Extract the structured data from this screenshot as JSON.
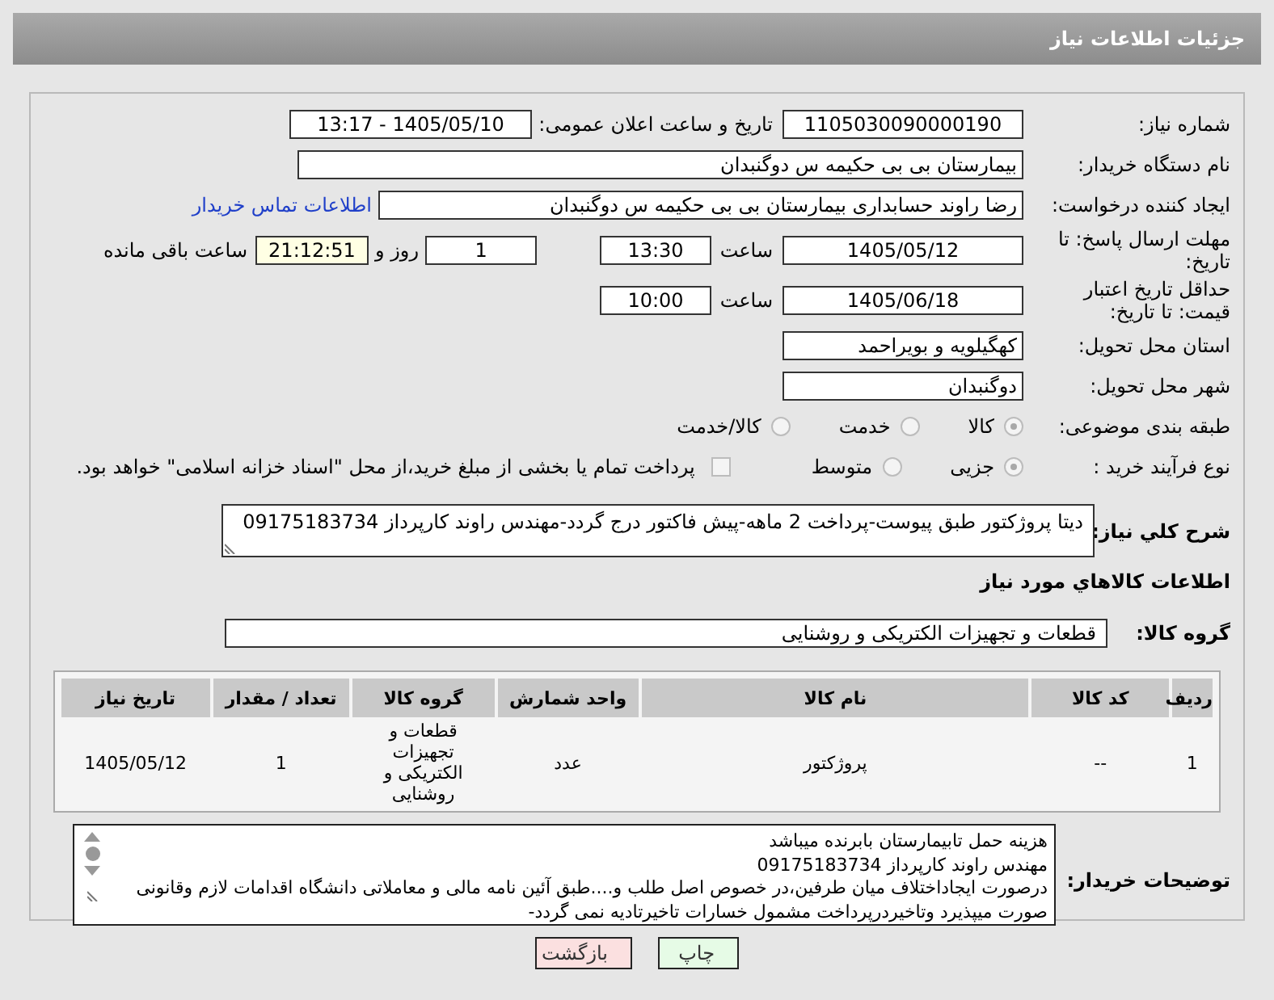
{
  "title": "جزئیات اطلاعات نیاز",
  "need_number": {
    "label": "شماره نیاز:",
    "value": "1105030090000190"
  },
  "announce": {
    "label": "تاریخ و ساعت اعلان عمومی:",
    "value": "1405/05/10 - 13:17"
  },
  "buyer_org": {
    "label": "نام دستگاه خریدار:",
    "value": "بیمارستان بی بی حکیمه س  دوگنبدان"
  },
  "requester": {
    "label": "ایجاد کننده درخواست:",
    "value": "رضا راوند حسابداری بیمارستان بی بی حکیمه س  دوگنبدان",
    "link": "اطلاعات تماس خریدار"
  },
  "reply_deadline": {
    "label": "مهلت ارسال پاسخ: تا تاریخ:",
    "date": "1405/05/12",
    "time_label": "ساعت",
    "time": "13:30",
    "days": "1",
    "days_label": "روز و",
    "remaining": "21:12:51",
    "remaining_label": "ساعت باقی مانده"
  },
  "price_validity": {
    "label": "حداقل تاریخ اعتبار قیمت: تا تاریخ:",
    "date": "1405/06/18",
    "time_label": "ساعت",
    "time": "10:00"
  },
  "province": {
    "label": "استان محل تحویل:",
    "value": "کهگیلویه و بویراحمد"
  },
  "city": {
    "label": "شهر محل تحویل:",
    "value": "دوگنبدان"
  },
  "category": {
    "label": "طبقه بندی موضوعی:",
    "options": [
      {
        "label": "کالا",
        "selected": true
      },
      {
        "label": "خدمت",
        "selected": false
      },
      {
        "label": "کالا/خدمت",
        "selected": false
      }
    ]
  },
  "process": {
    "label": "نوع فرآیند خرید :",
    "options": [
      {
        "label": "جزیی",
        "selected": true
      },
      {
        "label": "متوسط",
        "selected": false
      }
    ],
    "checkbox": {
      "label": "پرداخت تمام یا بخشی از مبلغ خرید،از محل \"اسناد خزانه اسلامی\" خواهد بود.",
      "checked": false
    }
  },
  "description": {
    "label": "شرح کلي نياز:",
    "value": "دیتا پروژکتور طبق پیوست-پرداخت 2 ماهه-پیش فاکتور درج گردد-مهندس راوند کارپرداز  09175183734"
  },
  "goods_heading": "اطلاعات كالاهاي مورد نياز",
  "goods_group": {
    "label": "گروه کالا:",
    "value": "قطعات و تجهیزات الکتریکی و روشنایی"
  },
  "table": {
    "columns": [
      "ردیف",
      "کد کالا",
      "نام کالا",
      "واحد شمارش",
      "گروه کالا",
      "تعداد / مقدار",
      "تاریخ نیاز"
    ],
    "rows": [
      [
        "1",
        "--",
        "پروژکتور",
        "عدد",
        "قطعات و تجهیزات الکتریکی و روشنایی",
        "1",
        "1405/05/12"
      ]
    ]
  },
  "buyer_notes": {
    "label": "توضیحات خریدار:",
    "lines": [
      "هزینه حمل تابیمارستان بابرنده میباشد",
      "مهندس  راوند کارپرداز  09175183734",
      "درصورت ایجاداختلاف میان طرفین،در خصوص اصل طلب و....طبق آئین نامه مالی و معاملاتی دانشگاه اقدامات لازم وقانونی",
      "صورت میپذیرد وتاخیردرپرداخت مشمول خسارات تاخیرتادیه نمی گردد-"
    ]
  },
  "buttons": [
    {
      "label": "چاپ",
      "kind": "print"
    },
    {
      "label": "بازگشت",
      "kind": "back"
    }
  ]
}
